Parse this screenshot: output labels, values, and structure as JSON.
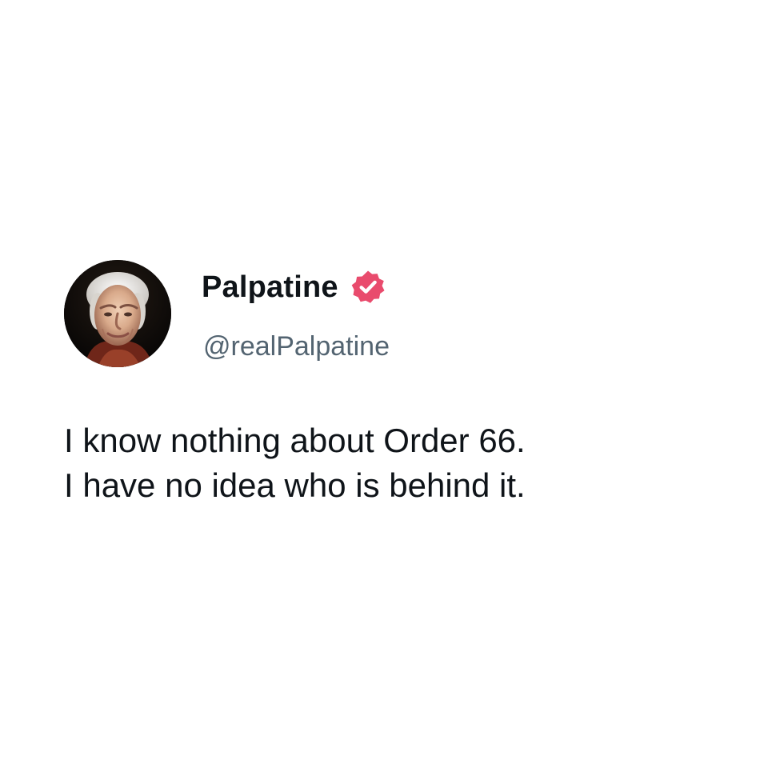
{
  "profile": {
    "display_name": "Palpatine",
    "handle": "@realPalpatine",
    "verified": true,
    "avatar_icon": "profile-photo-avatar",
    "verified_icon": "verified-badge-icon",
    "badge_color": "#e94b6d"
  },
  "post": {
    "lines": [
      "I know nothing about Order 66.",
      "I have no idea who is behind it."
    ]
  },
  "colors": {
    "background": "#ffffff",
    "primary_text": "#0f1419",
    "secondary_text": "#536471"
  }
}
